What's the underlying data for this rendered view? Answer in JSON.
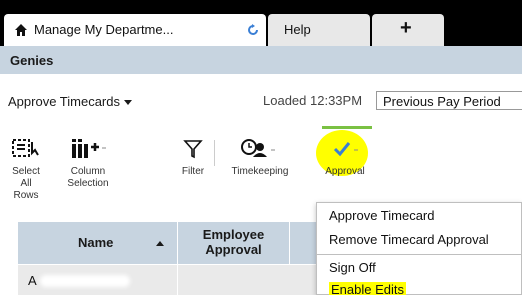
{
  "tabs": {
    "active_label": "Manage My Departme...",
    "help_label": "Help",
    "add_label": "+"
  },
  "genies": {
    "title": "Genies"
  },
  "header": {
    "approve_menu_label": "Approve Timecards",
    "loaded_text": "Loaded 12:33PM",
    "period_value": "Previous Pay Period"
  },
  "toolbar": {
    "select_all": "Select All\nRows",
    "column_selection": "Column\nSelection",
    "filter": "Filter",
    "timekeeping": "Timekeeping",
    "approval": "Approval"
  },
  "table": {
    "headers": [
      "Name",
      "Employee\nApproval"
    ],
    "rows": [
      {
        "name_initial": "A"
      }
    ]
  },
  "approval_menu": {
    "items": [
      "Approve Timecard",
      "Remove Timecard Approval",
      "Sign Off",
      "Enable Edits"
    ]
  },
  "colors": {
    "highlight": "#ffff00",
    "header_bg": "#c7d4e0",
    "accent_check": "#3a7fd5",
    "active_bar": "#7ac143"
  }
}
